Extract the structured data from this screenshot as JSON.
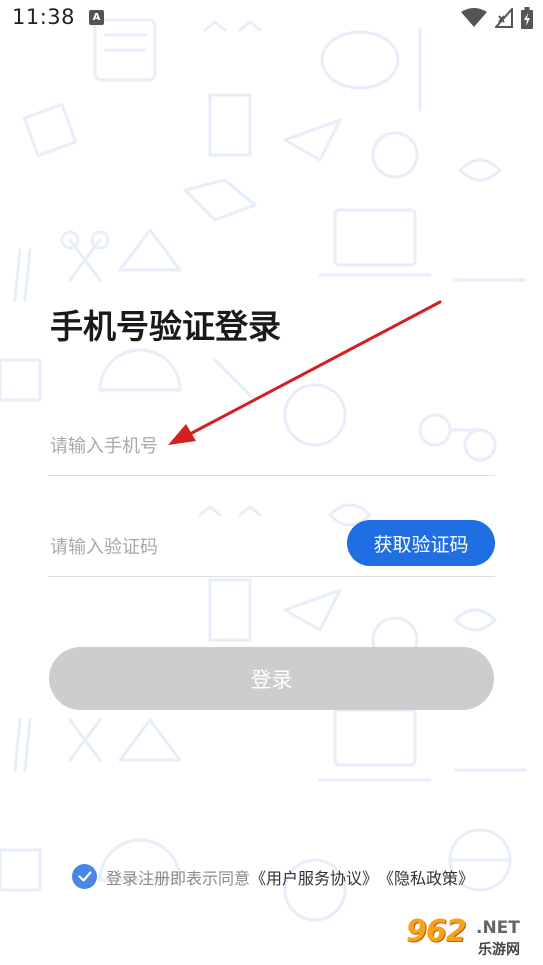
{
  "status_bar": {
    "time": "11:38",
    "notification_icon": "A"
  },
  "login": {
    "title": "手机号验证登录",
    "phone_placeholder": "请输入手机号",
    "code_placeholder": "请输入验证码",
    "get_code_label": "获取验证码",
    "login_label": "登录"
  },
  "agreement": {
    "checked": true,
    "prefix": "登录注册即表示同意",
    "user_agreement": "《用户服务协议》",
    "privacy_policy": "《隐私政策》"
  },
  "watermark": {
    "main": "962",
    "net": ".NET",
    "sub": "乐游网"
  },
  "colors": {
    "primary": "#1f6fe3",
    "login_disabled": "#cdcdcd",
    "checkbox": "#4a86e8",
    "annotation_arrow": "#d42020"
  },
  "icons": [
    "wifi-icon",
    "signal-icon",
    "battery-icon",
    "check-icon",
    "annotation-arrow"
  ]
}
